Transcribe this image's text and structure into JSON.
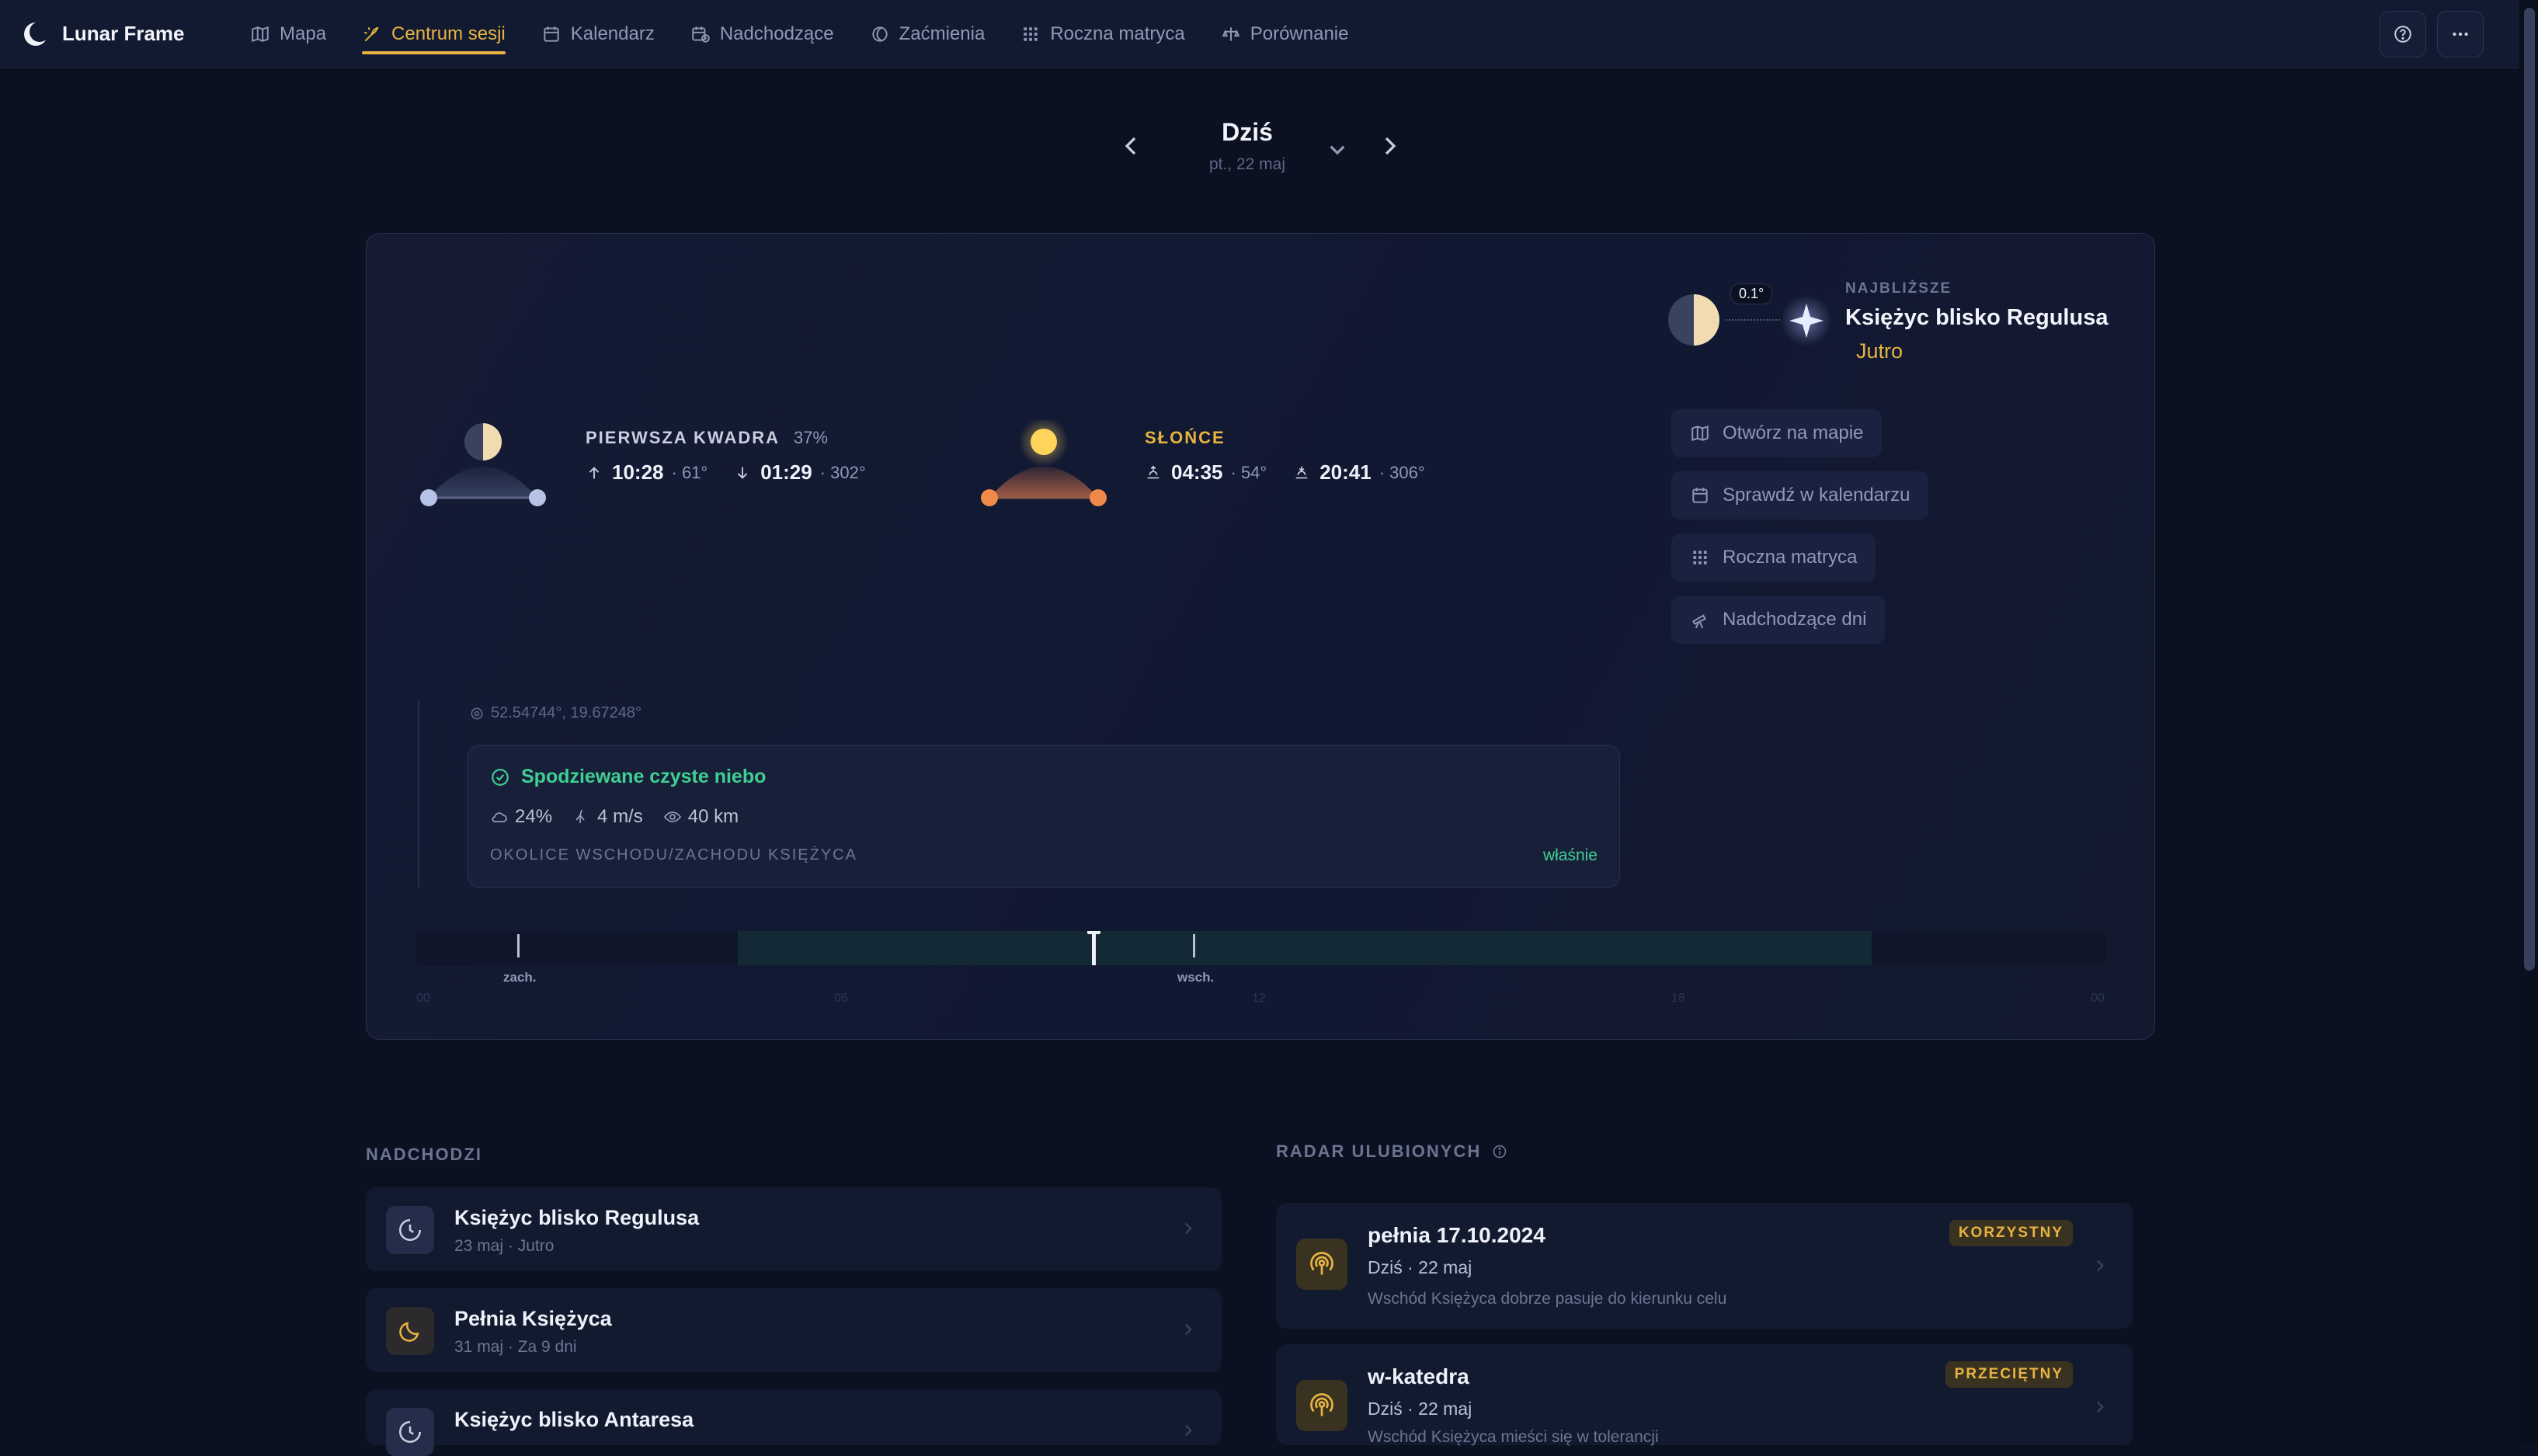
{
  "app": {
    "name": "Lunar Frame"
  },
  "nav": {
    "tabs": [
      {
        "label": "Mapa",
        "icon": "map-icon"
      },
      {
        "label": "Centrum sesji",
        "icon": "session-icon",
        "active": true
      },
      {
        "label": "Kalendarz",
        "icon": "calendar-icon"
      },
      {
        "label": "Nadchodzące",
        "icon": "calendar-upcoming-icon"
      },
      {
        "label": "Zaćmienia",
        "icon": "eclipse-icon"
      },
      {
        "label": "Roczna matryca",
        "icon": "grid-icon"
      },
      {
        "label": "Porównanie",
        "icon": "compare-icon"
      }
    ]
  },
  "date": {
    "title": "Dziś",
    "subtitle": "pt., 22 maj"
  },
  "moon": {
    "phase_label": "PIERWSZA KWADRA",
    "illumination": "37%",
    "rise_time": "10:28",
    "rise_az": "· 61°",
    "set_time": "01:29",
    "set_az": "· 302°"
  },
  "sun": {
    "label": "SŁOŃCE",
    "rise_time": "04:35",
    "rise_az": "· 54°",
    "set_time": "20:41",
    "set_az": "· 306°"
  },
  "nearest": {
    "caption": "NAJBLIŻSZE",
    "title": "Księżyc blisko Regulusa",
    "when": "Jutro",
    "separation": "0.1°"
  },
  "actions": [
    {
      "label": "Otwórz na mapie",
      "icon": "map-icon"
    },
    {
      "label": "Sprawdź w kalendarzu",
      "icon": "calendar-icon"
    },
    {
      "label": "Roczna matryca",
      "icon": "grid-icon"
    },
    {
      "label": "Nadchodzące dni",
      "icon": "telescope-icon"
    }
  ],
  "location": {
    "coords": "52.54744°, 19.67248°"
  },
  "weather": {
    "title": "Spodziewane czyste niebo",
    "cloud": "24%",
    "wind": "4 m/s",
    "visibility": "40 km",
    "note": "OKOLICE WSCHODU/ZACHODU KSIĘŻYCA",
    "updated": "właśnie"
  },
  "timeline": {
    "set_label": "zach.",
    "rise_label": "wsch.",
    "hours": [
      "00",
      "06",
      "12",
      "18",
      "00"
    ]
  },
  "upcoming": {
    "caption": "NADCHODZI",
    "items": [
      {
        "title": "Księżyc blisko Regulusa",
        "sub": "23 maj · Jutro",
        "icon": "conjunction-icon"
      },
      {
        "title": "Pełnia Księżyca",
        "sub": "31 maj · Za 9 dni",
        "icon": "moon-icon"
      },
      {
        "title": "Księżyc blisko Antaresa",
        "sub": "",
        "icon": "conjunction-icon"
      }
    ]
  },
  "favorites": {
    "caption": "RADAR ULUBIONYCH",
    "items": [
      {
        "title": "pełnia 17.10.2024",
        "sub": "Dziś · 22 maj",
        "desc": "Wschód Księżyca dobrze pasuje do kierunku celu",
        "badge": "KORZYSTNY",
        "icon": "radar-icon"
      },
      {
        "title": "w-katedra",
        "sub": "Dziś · 22 maj",
        "desc": "Wschód Księżyca mieści się w tolerancji",
        "badge": "PRZECIĘTNY",
        "icon": "radar-icon"
      }
    ]
  },
  "colors": {
    "accent": "#e7b441",
    "good": "#3fcf93",
    "background": "#0c1121"
  }
}
